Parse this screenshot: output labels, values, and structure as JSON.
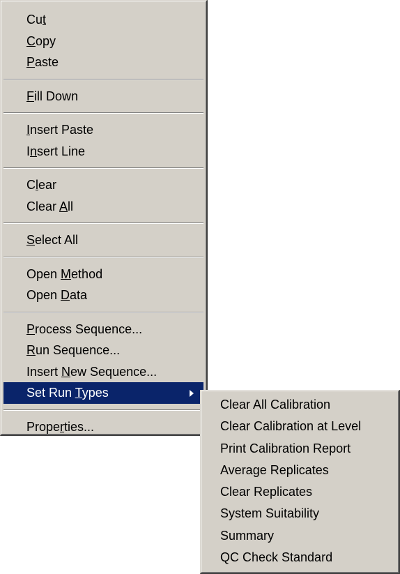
{
  "context_menu": {
    "items": [
      {
        "label": "Cut",
        "mnemonic_index": 2
      },
      {
        "label": "Copy",
        "mnemonic_index": 0
      },
      {
        "label": "Paste",
        "mnemonic_index": 0
      },
      {
        "label": "Fill Down",
        "mnemonic_index": 0
      },
      {
        "label": "Insert Paste",
        "mnemonic_index": 0
      },
      {
        "label": "Insert Line",
        "mnemonic_index": 1
      },
      {
        "label": "Clear",
        "mnemonic_index": 1
      },
      {
        "label": "Clear All",
        "mnemonic_index": 6
      },
      {
        "label": "Select All",
        "mnemonic_index": 0
      },
      {
        "label": "Open Method",
        "mnemonic_index": 5
      },
      {
        "label": "Open Data",
        "mnemonic_index": 5
      },
      {
        "label": "Process Sequence...",
        "mnemonic_index": 0
      },
      {
        "label": "Run Sequence...",
        "mnemonic_index": 0
      },
      {
        "label": "Insert New Sequence...",
        "mnemonic_index": 7
      },
      {
        "label": "Set Run Types",
        "mnemonic_index": 8
      },
      {
        "label": "Properties...",
        "mnemonic_index": 5
      }
    ]
  },
  "submenu": {
    "items": [
      {
        "label": "Clear All Calibration"
      },
      {
        "label": "Clear Calibration at Level"
      },
      {
        "label": "Print Calibration Report"
      },
      {
        "label": "Average Replicates"
      },
      {
        "label": "Clear Replicates"
      },
      {
        "label": "System Suitability"
      },
      {
        "label": "Summary"
      },
      {
        "label": "QC Check Standard"
      }
    ]
  },
  "colors": {
    "menu_bg": "#d4d0c8",
    "highlight_bg": "#0a246a",
    "highlight_fg": "#ffffff"
  }
}
